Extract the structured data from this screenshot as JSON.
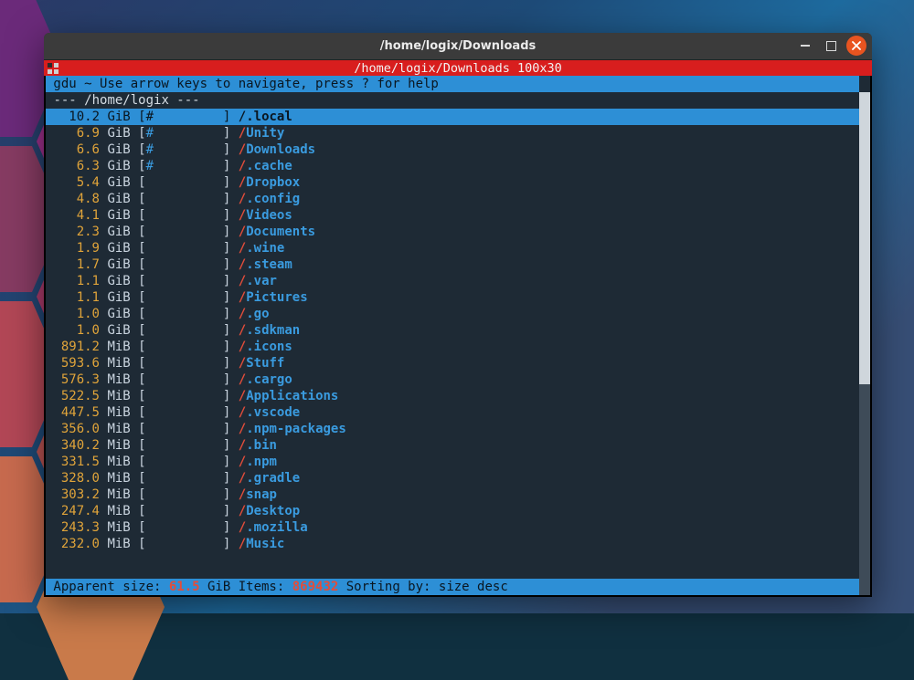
{
  "window": {
    "title": "/home/logix/Downloads"
  },
  "tab": {
    "title": "/home/logix/Downloads 100x30"
  },
  "header": {
    "text": " gdu ~ Use arrow keys to navigate, press ? for help"
  },
  "breadcrumb": {
    "text": "--- /home/logix ---"
  },
  "rows": [
    {
      "size": "10.2",
      "unit": "GiB",
      "bar": "#",
      "name": ".local",
      "selected": true
    },
    {
      "size": "6.9",
      "unit": "GiB",
      "bar": "#",
      "name": "Unity"
    },
    {
      "size": "6.6",
      "unit": "GiB",
      "bar": "#",
      "name": "Downloads"
    },
    {
      "size": "6.3",
      "unit": "GiB",
      "bar": "#",
      "name": ".cache"
    },
    {
      "size": "5.4",
      "unit": "GiB",
      "bar": " ",
      "name": "Dropbox"
    },
    {
      "size": "4.8",
      "unit": "GiB",
      "bar": " ",
      "name": ".config"
    },
    {
      "size": "4.1",
      "unit": "GiB",
      "bar": " ",
      "name": "Videos"
    },
    {
      "size": "2.3",
      "unit": "GiB",
      "bar": " ",
      "name": "Documents"
    },
    {
      "size": "1.9",
      "unit": "GiB",
      "bar": " ",
      "name": ".wine"
    },
    {
      "size": "1.7",
      "unit": "GiB",
      "bar": " ",
      "name": ".steam"
    },
    {
      "size": "1.1",
      "unit": "GiB",
      "bar": " ",
      "name": ".var"
    },
    {
      "size": "1.1",
      "unit": "GiB",
      "bar": " ",
      "name": "Pictures"
    },
    {
      "size": "1.0",
      "unit": "GiB",
      "bar": " ",
      "name": ".go"
    },
    {
      "size": "1.0",
      "unit": "GiB",
      "bar": " ",
      "name": ".sdkman"
    },
    {
      "size": "891.2",
      "unit": "MiB",
      "bar": " ",
      "name": ".icons"
    },
    {
      "size": "593.6",
      "unit": "MiB",
      "bar": " ",
      "name": "Stuff"
    },
    {
      "size": "576.3",
      "unit": "MiB",
      "bar": " ",
      "name": ".cargo"
    },
    {
      "size": "522.5",
      "unit": "MiB",
      "bar": " ",
      "name": "Applications"
    },
    {
      "size": "447.5",
      "unit": "MiB",
      "bar": " ",
      "name": ".vscode"
    },
    {
      "size": "356.0",
      "unit": "MiB",
      "bar": " ",
      "name": ".npm-packages"
    },
    {
      "size": "340.2",
      "unit": "MiB",
      "bar": " ",
      "name": ".bin"
    },
    {
      "size": "331.5",
      "unit": "MiB",
      "bar": " ",
      "name": ".npm"
    },
    {
      "size": "328.0",
      "unit": "MiB",
      "bar": " ",
      "name": ".gradle"
    },
    {
      "size": "303.2",
      "unit": "MiB",
      "bar": " ",
      "name": "snap"
    },
    {
      "size": "247.4",
      "unit": "MiB",
      "bar": " ",
      "name": "Desktop"
    },
    {
      "size": "243.3",
      "unit": "MiB",
      "bar": " ",
      "name": ".mozilla"
    },
    {
      "size": "232.0",
      "unit": "MiB",
      "bar": " ",
      "name": "Music"
    }
  ],
  "footer": {
    "label_apparent": " Apparent size: ",
    "total_size": "61.5",
    "label_unit_items": " GiB Items: ",
    "item_count": "869432",
    "label_sort": " Sorting by: size desc"
  }
}
